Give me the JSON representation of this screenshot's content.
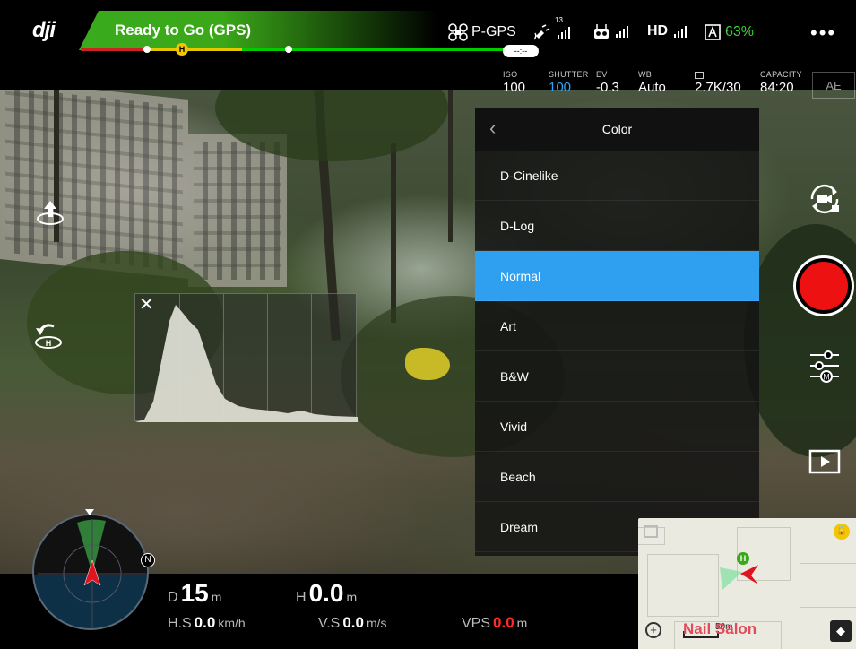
{
  "top_bar": {
    "logo": "dji",
    "status": "Ready to Go (GPS)",
    "time_remaining": "--:--",
    "flight_mode": "P-GPS",
    "satellite_count": "13",
    "hd_label": "HD",
    "battery_percent": "63%",
    "more_icon": "more-dots-icon",
    "home_marker": "H"
  },
  "camera_params": [
    {
      "label": "ISO",
      "value": "100",
      "color": "#ffffff"
    },
    {
      "label": "SHUTTER",
      "value": "100",
      "color": "#29a7ff"
    },
    {
      "label": "EV",
      "value": "-0.3",
      "color": "#ffffff"
    },
    {
      "label": "WB",
      "value": "Auto",
      "color": "#ffffff"
    },
    {
      "label": "",
      "value": "2.7K/30",
      "color": "#ffffff"
    },
    {
      "label": "CAPACITY",
      "value": "84:20",
      "color": "#ffffff"
    }
  ],
  "ae_lock": "AE",
  "color_menu": {
    "title": "Color",
    "items": [
      "D-Cinelike",
      "D-Log",
      "Normal",
      "Art",
      "B&W",
      "Vivid",
      "Beach",
      "Dream"
    ],
    "selected": "Normal",
    "selected_color": "#2f9ff0"
  },
  "telemetry": {
    "distance": {
      "label": "D",
      "value": "15",
      "unit": "m"
    },
    "height": {
      "label": "H",
      "value": "0.0",
      "unit": "m"
    },
    "h_speed": {
      "label": "H.S",
      "value": "0.0",
      "unit": "km/h"
    },
    "v_speed": {
      "label": "V.S",
      "value": "0.0",
      "unit": "m/s"
    },
    "vps": {
      "label": "VPS",
      "value": "0.0",
      "unit": "m",
      "color": "#ff2a2a"
    }
  },
  "radar": {
    "north_label": "N"
  },
  "minimap": {
    "scale": "50m",
    "poi": "Nail Salon",
    "home_marker": "H"
  },
  "icons": {
    "takeoff": "takeoff-icon",
    "return_home": "return-home-icon",
    "camera_switch": "camera-switch-icon",
    "record": "record-button",
    "camera_settings": "camera-settings-icon",
    "playback": "playback-icon"
  }
}
